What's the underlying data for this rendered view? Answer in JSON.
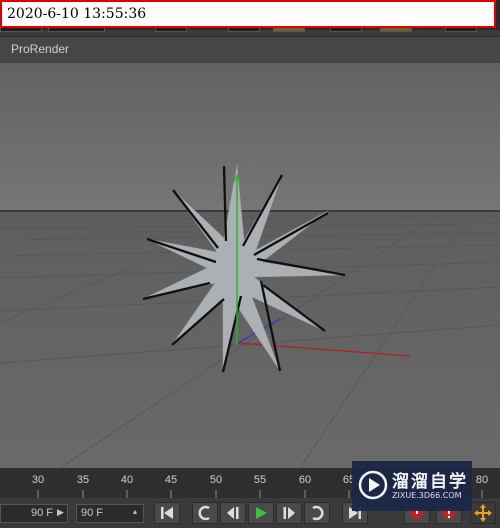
{
  "timestamp": "2020-6-10 13:55:36",
  "viewport": {
    "title": "ProRender"
  },
  "timeline": {
    "ticks": [
      "30",
      "35",
      "40",
      "45",
      "50",
      "55",
      "60",
      "65",
      "80"
    ]
  },
  "transport": {
    "end_frame": "90 F",
    "preview_end": "90 F",
    "buttons": [
      "go-to-start",
      "previous-key",
      "step-back",
      "play",
      "step-forward",
      "next-key",
      "go-to-end",
      "record",
      "autokey",
      "move-tool"
    ]
  },
  "watermark": {
    "title": "溜溜自学",
    "url": "ZIXUE.3D66.COM"
  },
  "colors": {
    "axis_x": "#c02020",
    "axis_y": "#30b030",
    "axis_z": "#2b3bd0",
    "frame": "#e00000"
  }
}
